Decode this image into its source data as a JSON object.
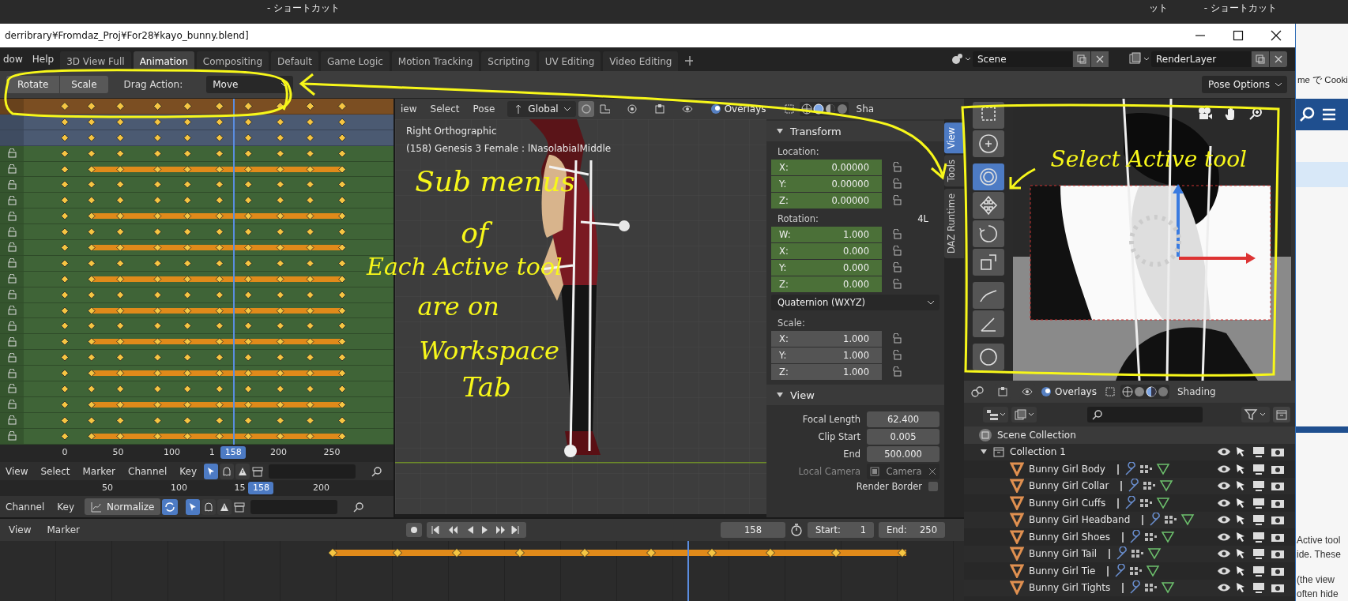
{
  "background_window": {
    "texts": [
      "- ショートカット",
      "ット",
      "- ショートカット"
    ]
  },
  "window": {
    "title": "derribrary¥Fromdaz_Proj¥For28¥kayo_bunny.blend]"
  },
  "menu": [
    "dow",
    "Help"
  ],
  "workspace_tabs": [
    {
      "label": "3D View Full",
      "selected": false
    },
    {
      "label": "Animation",
      "selected": true
    },
    {
      "label": "Compositing",
      "selected": false
    },
    {
      "label": "Default",
      "selected": false
    },
    {
      "label": "Game Logic",
      "selected": false
    },
    {
      "label": "Motion Tracking",
      "selected": false
    },
    {
      "label": "Scripting",
      "selected": false
    },
    {
      "label": "UV Editing",
      "selected": false
    },
    {
      "label": "Video Editing",
      "selected": false
    }
  ],
  "scene": {
    "name": "Scene"
  },
  "view_layer": {
    "name": "RenderLayer"
  },
  "tool_settings": {
    "buttons": [
      "Rotate",
      "Scale"
    ],
    "drag_label": "Drag Action:",
    "drag_value": "Move",
    "pose_options": "Pose Options"
  },
  "dopesheet": {
    "rows": [
      {
        "kind": "summary",
        "hold": false
      },
      {
        "kind": "object",
        "hold": false
      },
      {
        "kind": "object",
        "hold": false
      },
      {
        "kind": "bone",
        "hold": false
      },
      {
        "kind": "bone",
        "hold": true
      },
      {
        "kind": "bone",
        "hold": false
      },
      {
        "kind": "bone",
        "hold": false
      },
      {
        "kind": "bone",
        "hold": true
      },
      {
        "kind": "bone",
        "hold": false
      },
      {
        "kind": "bone",
        "hold": true
      },
      {
        "kind": "bone",
        "hold": false
      },
      {
        "kind": "bone",
        "hold": true
      },
      {
        "kind": "bone",
        "hold": false
      },
      {
        "kind": "bone",
        "hold": true
      },
      {
        "kind": "bone",
        "hold": false
      },
      {
        "kind": "bone",
        "hold": true
      },
      {
        "kind": "bone",
        "hold": false
      },
      {
        "kind": "bone",
        "hold": true
      },
      {
        "kind": "bone",
        "hold": false
      },
      {
        "kind": "bone",
        "hold": true
      },
      {
        "kind": "bone",
        "hold": false
      },
      {
        "kind": "bone",
        "hold": true
      }
    ],
    "ruler": [
      "0",
      "50",
      "100",
      "1",
      "200",
      "250"
    ],
    "current_frame": "158",
    "menu": [
      "View",
      "Select",
      "Marker",
      "Channel",
      "Key"
    ]
  },
  "graph_editor": {
    "ruler": [
      "50",
      "100",
      "15",
      "200"
    ],
    "current_frame": "158",
    "menu": [
      "Channel",
      "Key"
    ],
    "normalize": "Normalize"
  },
  "viewport": {
    "menu": [
      "iew",
      "Select",
      "Pose"
    ],
    "orientation": "Global",
    "overlays": "Overlays",
    "shading": "Sha",
    "view_name": "Right Orthographic",
    "object_info": "(158) Genesis 3 Female : lNasolabialMiddle"
  },
  "sidebar": {
    "tabs": [
      {
        "label": "View",
        "selected": true
      },
      {
        "label": "Tools",
        "selected": false
      },
      {
        "label": "DAZ Runtime",
        "selected": false
      }
    ],
    "transform": {
      "title": "Transform",
      "expanded": true,
      "location_label": "Location:",
      "location": [
        {
          "axis": "X:",
          "value": "0.00000",
          "keyed": true
        },
        {
          "axis": "Y:",
          "value": "0.00000",
          "keyed": true
        },
        {
          "axis": "Z:",
          "value": "0.00000",
          "keyed": true
        }
      ],
      "rotation_label": "Rotation:",
      "rotation_lock": "4L",
      "rotation": [
        {
          "axis": "W:",
          "value": "1.000",
          "keyed": true
        },
        {
          "axis": "X:",
          "value": "0.000",
          "keyed": true
        },
        {
          "axis": "Y:",
          "value": "0.000",
          "keyed": true
        },
        {
          "axis": "Z:",
          "value": "0.000",
          "keyed": true
        }
      ],
      "rotation_mode": "Quaternion (WXYZ)",
      "scale_label": "Scale:",
      "scale": [
        {
          "axis": "X:",
          "value": "1.000",
          "keyed": false
        },
        {
          "axis": "Y:",
          "value": "1.000",
          "keyed": false
        },
        {
          "axis": "Z:",
          "value": "1.000",
          "keyed": false
        }
      ]
    },
    "view": {
      "title": "View",
      "expanded": true,
      "fields": [
        {
          "label": "Focal Length",
          "value": "62.400"
        },
        {
          "label": "Clip Start",
          "value": "0.005"
        },
        {
          "label": "End",
          "value": "500.000"
        }
      ],
      "local_camera": {
        "label": "Local Camera",
        "value": "Camera",
        "disabled": true
      },
      "render_border": {
        "label": "Render Border",
        "checked": false
      }
    }
  },
  "tool_shelf": {
    "tools": [
      {
        "selected": false
      },
      {
        "selected": false
      },
      {
        "selected": true
      },
      {
        "selected": false
      },
      {
        "selected": false
      },
      {
        "selected": false
      },
      {
        "selected": false
      },
      {
        "selected": false
      },
      {
        "selected": false
      }
    ],
    "overlays": "Overlays",
    "shading": "Shading"
  },
  "outliner": {
    "scene_collection": "Scene Collection",
    "collections": [
      {
        "name": "Collection 1",
        "expanded": true,
        "children": [
          {
            "name": "Bunny Girl Body"
          },
          {
            "name": "Bunny Girl Collar"
          },
          {
            "name": "Bunny Girl Cuffs"
          },
          {
            "name": "Bunny Girl Headband"
          },
          {
            "name": "Bunny Girl Shoes"
          },
          {
            "name": "Bunny Girl Tail"
          },
          {
            "name": "Bunny Girl Tie"
          },
          {
            "name": "Bunny Girl Tights"
          }
        ]
      }
    ]
  },
  "timeline": {
    "menu": [
      "View",
      "Marker"
    ],
    "current_frame": "158",
    "start_label": "Start:",
    "start": "1",
    "end_label": "End:",
    "end": "250"
  },
  "browser": {
    "header_text": "me で Cooki",
    "texts": [
      "Active tool",
      "ide. These",
      "(the view",
      "often hide"
    ]
  },
  "annotations": {
    "left": [
      "Sub menus",
      "of",
      "Each Active tool",
      "are on",
      "Workspace",
      "Tab"
    ],
    "right": "Select Active tool"
  }
}
